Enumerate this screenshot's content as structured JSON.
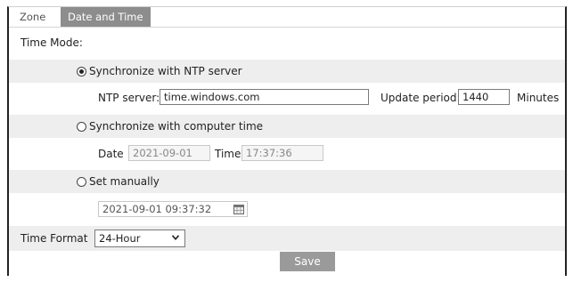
{
  "tabs": [
    {
      "label": "Zone"
    },
    {
      "label": "Date and Time"
    }
  ],
  "time_mode": {
    "label": "Time Mode:",
    "ntp_option": "Synchronize with NTP server",
    "ntp_server_label": "NTP server:",
    "ntp_server_value": "time.windows.com",
    "update_period_label": "Update period:",
    "update_period_value": "1440",
    "update_period_unit": "Minutes",
    "computer_option": "Synchronize with computer time",
    "date_label": "Date",
    "date_value": "2021-09-01",
    "time_label": "Time",
    "time_value": "17:37:36",
    "manual_option": "Set manually",
    "manual_value": "2021-09-01 09:37:32",
    "selected": "ntp"
  },
  "time_format": {
    "label": "Time Format",
    "value": "24-Hour"
  },
  "save_label": "Save",
  "icons": {
    "calendar": "calendar-icon",
    "dropdown": "chevron-down-icon"
  }
}
